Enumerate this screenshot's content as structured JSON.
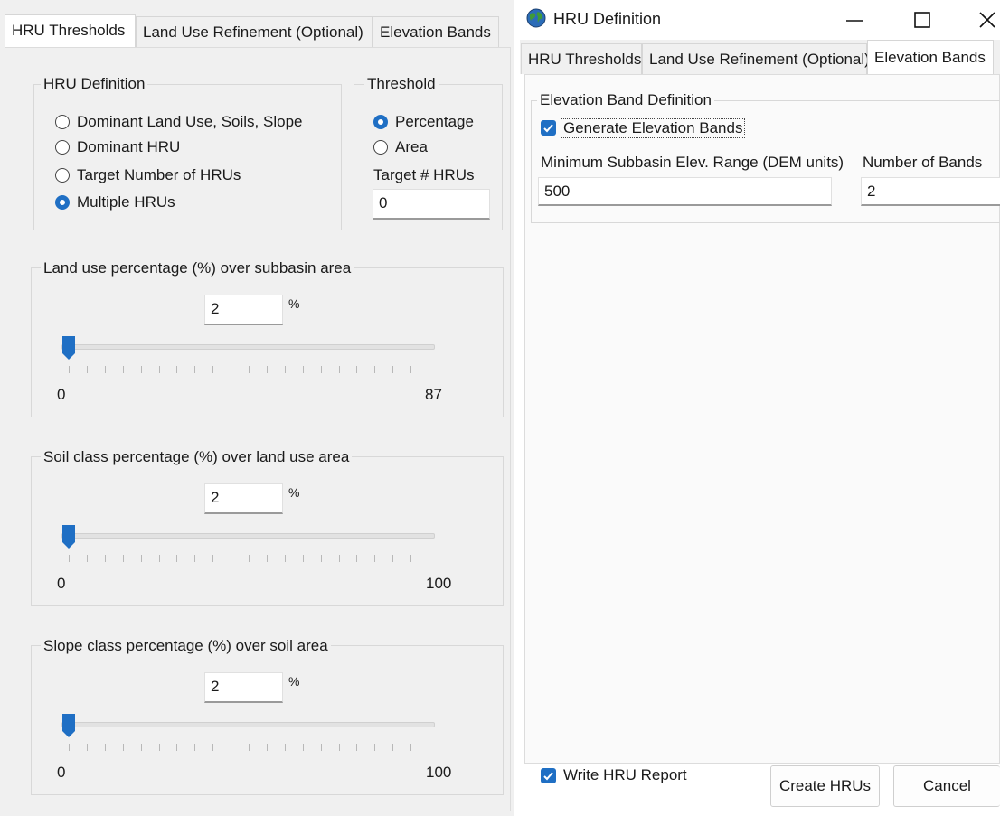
{
  "left": {
    "tabs": [
      "HRU Thresholds",
      "Land Use Refinement (Optional)",
      "Elevation Bands"
    ],
    "hru_definition": {
      "legend": "HRU Definition",
      "options": [
        "Dominant Land Use, Soils, Slope",
        "Dominant HRU",
        "Target Number of HRUs",
        "Multiple HRUs"
      ],
      "selected": "Multiple HRUs"
    },
    "threshold": {
      "legend": "Threshold",
      "options": [
        "Percentage",
        "Area"
      ],
      "selected": "Percentage",
      "target_label": "Target # HRUs",
      "target_value": "0"
    },
    "sliders": [
      {
        "title": "Land use percentage (%) over subbasin area",
        "value": "2",
        "unit": "%",
        "min": "0",
        "max": "87",
        "level": 0
      },
      {
        "title": "Soil class percentage (%) over land use area",
        "value": "2",
        "unit": "%",
        "min": "0",
        "max": "100",
        "level": 0
      },
      {
        "title": "Slope class percentage (%) over soil area",
        "value": "2",
        "unit": "%",
        "min": "0",
        "max": "100",
        "level": 0
      }
    ]
  },
  "right": {
    "window_title": "HRU Definition",
    "tabs": [
      "HRU Thresholds",
      "Land Use Refinement (Optional)",
      "Elevation Bands"
    ],
    "active_tab": "Elevation Bands",
    "elevation": {
      "legend": "Elevation Band Definition",
      "generate_label": "Generate Elevation Bands",
      "generate_checked": true,
      "min_range_label": "Minimum Subbasin Elev. Range (DEM units)",
      "min_range_value": "500",
      "num_bands_label": "Number of Bands",
      "num_bands_value": "2"
    },
    "write_report_label": "Write HRU Report",
    "write_report_checked": true,
    "create_button": "Create HRUs",
    "cancel_button": "Cancel"
  },
  "colors": {
    "accent": "#1f6fc4",
    "panel": "#f0f0f0"
  },
  "icons": {
    "app": "globe-icon",
    "minimize": "minimize-icon",
    "maximize": "maximize-icon",
    "close": "close-icon"
  }
}
